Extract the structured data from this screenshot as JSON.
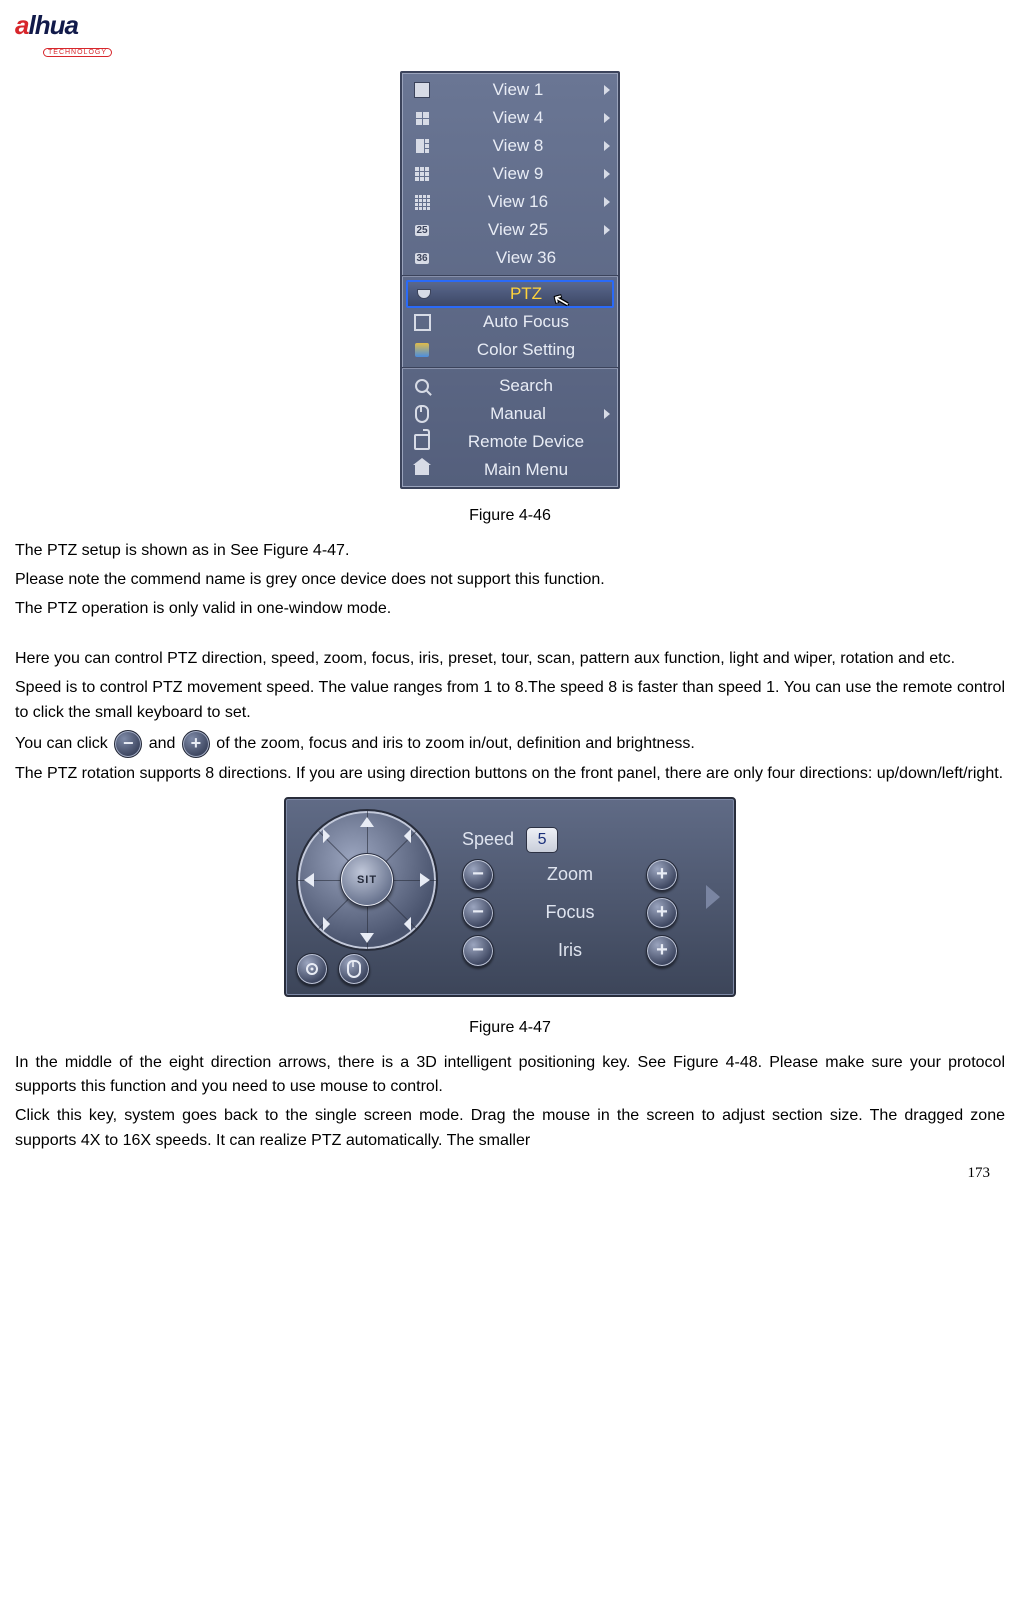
{
  "logo": {
    "red": "a",
    "blue": "lhua",
    "sub": "TECHNOLOGY"
  },
  "menu": {
    "group1": [
      {
        "label": "View 1",
        "sub": true
      },
      {
        "label": "View 4",
        "sub": true
      },
      {
        "label": "View 8",
        "sub": true
      },
      {
        "label": "View 9",
        "sub": true
      },
      {
        "label": "View 16",
        "sub": true
      },
      {
        "label": "View 25",
        "sub": true
      },
      {
        "label": "View 36",
        "sub": false
      }
    ],
    "group2": [
      {
        "label": "PTZ",
        "selected": true
      },
      {
        "label": "Auto Focus"
      },
      {
        "label": "Color Setting"
      }
    ],
    "group3": [
      {
        "label": "Search"
      },
      {
        "label": "Manual",
        "sub": true
      },
      {
        "label": "Remote Device"
      },
      {
        "label": "Main Menu"
      }
    ]
  },
  "captions": {
    "fig46": "Figure 4-46",
    "fig47": "Figure 4-47"
  },
  "text": {
    "p1": "The PTZ setup is shown as in See Figure 4-47.",
    "p2": "Please note the commend name is grey once device does not support this function.",
    "p3": "The PTZ operation is only valid in one-window mode.",
    "p4": "Here you can control PTZ direction, speed, zoom, focus, iris, preset, tour, scan, pattern aux function, light and wiper, rotation and etc.",
    "p5": "Speed is to control PTZ movement speed. The value ranges from 1 to 8.The speed 8 is faster than speed 1. You can use the remote control to click the small keyboard to set.",
    "p6a": "You can click ",
    "p6b": " and ",
    "p6c": " of the zoom, focus and iris to zoom in/out, definition and brightness.",
    "p7": "The PTZ rotation supports 8 directions. If you are using direction buttons on the front panel, there are only four directions: up/down/left/right.",
    "p8": "In the middle of the eight direction arrows, there is a 3D intelligent positioning key. See Figure 4-48. Please make sure your protocol supports this function and you need to use mouse to control.",
    "p9": "Click this key, system goes back to the single screen mode. Drag the mouse in the screen to adjust section size. The dragged zone supports 4X to 16X speeds. It can realize PTZ automatically. The smaller"
  },
  "ptz": {
    "sit": "SIT",
    "speed_label": "Speed",
    "speed_value": "5",
    "zoom": "Zoom",
    "focus": "Focus",
    "iris": "Iris"
  },
  "page_number": "173"
}
